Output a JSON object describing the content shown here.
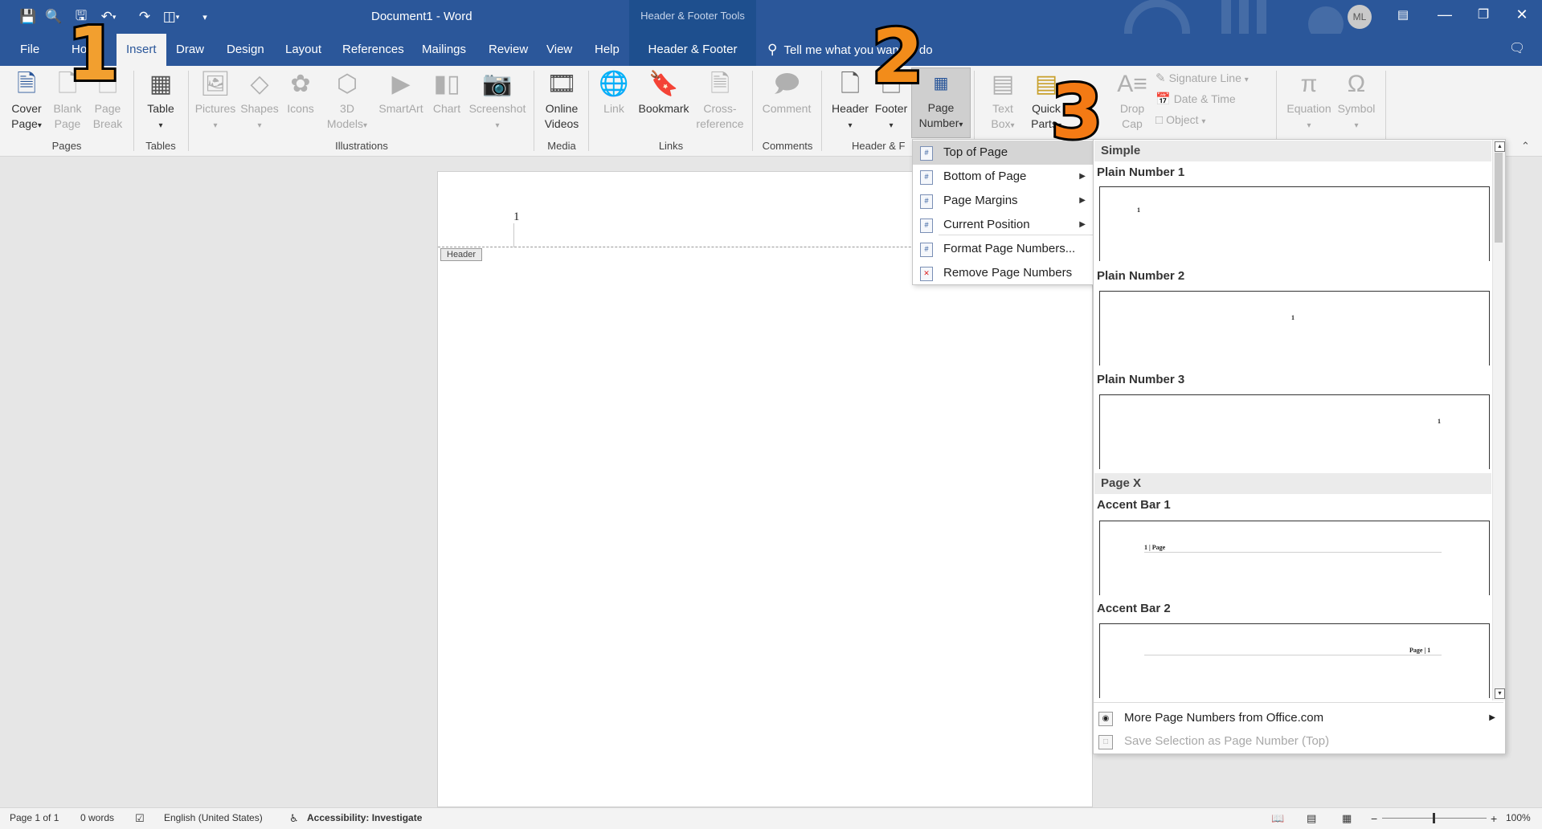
{
  "window": {
    "doc_title": "Document1  -  Word",
    "context_title": "Header & Footer Tools",
    "avatar_initials": "ML",
    "accent_color": "#2b579a"
  },
  "quick_access": [
    "save-icon",
    "print-preview-icon",
    "save-as-icon",
    "undo-icon",
    "redo-icon",
    "layout-icon",
    "customize-icon"
  ],
  "tabs": {
    "file": "File",
    "home": "Home",
    "insert": "Insert",
    "draw": "Draw",
    "design": "Design",
    "layout": "Layout",
    "references": "References",
    "mailings": "Mailings",
    "review": "Review",
    "view": "View",
    "help": "Help",
    "header_footer": "Header & Footer",
    "tell_me": "Tell me what you want to do"
  },
  "ribbon": {
    "cover_page": "Cover\nPage",
    "blank_page": "Blank\nPage",
    "page_break": "Page\nBreak",
    "table": "Table",
    "pictures": "Pictures",
    "shapes": "Shapes",
    "icons": "Icons",
    "models_3d": "3D\nModels",
    "smartart": "SmartArt",
    "chart": "Chart",
    "screenshot": "Screenshot",
    "online_videos": "Online\nVideos",
    "link": "Link",
    "bookmark": "Bookmark",
    "cross_reference": "Cross-\nreference",
    "comment": "Comment",
    "header": "Header",
    "footer": "Footer",
    "page_number": "Page\nNumber",
    "text_box": "Text\nBox",
    "quick_parts": "Quick\nParts",
    "drop_cap": "Drop\nCap",
    "signature_line": "Signature Line",
    "date_time": "Date & Time",
    "object": "Object",
    "equation": "Equation",
    "symbol": "Symbol",
    "groups": {
      "pages": "Pages",
      "tables": "Tables",
      "illustrations": "Illustrations",
      "media": "Media",
      "links": "Links",
      "comments": "Comments",
      "header_footer": "Header & F"
    }
  },
  "document": {
    "page_number_text": "1",
    "header_tag": "Header"
  },
  "menu": {
    "items": [
      {
        "label": "Top of Page",
        "submenu": false,
        "highlighted": true
      },
      {
        "label": "Bottom of Page",
        "submenu": true
      },
      {
        "label": "Page Margins",
        "submenu": true
      },
      {
        "label": "Current Position",
        "submenu": true
      },
      {
        "label": "Format Page Numbers...",
        "submenu": false
      },
      {
        "label": "Remove Page Numbers",
        "submenu": false
      }
    ]
  },
  "gallery": {
    "section_simple": "Simple",
    "section_pagex": "Page X",
    "items": [
      {
        "title": "Plain Number 1",
        "sample": "1"
      },
      {
        "title": "Plain Number 2",
        "sample": "1"
      },
      {
        "title": "Plain Number 3",
        "sample": "1"
      },
      {
        "title": "Accent Bar 1",
        "sample": "1 | Page"
      },
      {
        "title": "Accent Bar 2",
        "sample": "Page | 1"
      }
    ],
    "more_from_office": "More Page Numbers from Office.com",
    "save_selection": "Save Selection as Page Number (Top)"
  },
  "annotations": [
    "1",
    "2",
    "3"
  ],
  "annotation_colors": {
    "one": "#f29f2f",
    "two": "#f28c1a",
    "three": "#f47a14"
  },
  "status": {
    "page": "Page 1 of 1",
    "words": "0 words",
    "language": "English (United States)",
    "accessibility": "Accessibility: Investigate",
    "zoom": "100%"
  }
}
